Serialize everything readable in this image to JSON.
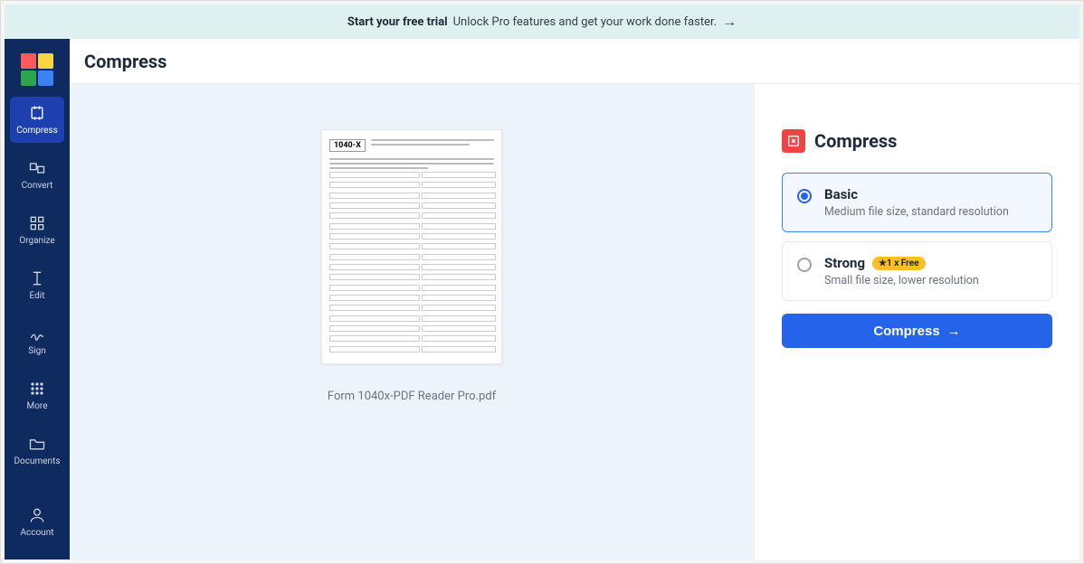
{
  "banner": {
    "bold": "Start your free trial",
    "text": "Unlock Pro features and get your work done faster."
  },
  "header": {
    "title": "Compress"
  },
  "sidebar": {
    "items": [
      {
        "label": "Compress",
        "active": true
      },
      {
        "label": "Convert",
        "active": false
      },
      {
        "label": "Organize",
        "active": false
      },
      {
        "label": "Edit",
        "active": false
      },
      {
        "label": "Sign",
        "active": false
      },
      {
        "label": "More",
        "active": false
      },
      {
        "label": "Documents",
        "active": false
      }
    ],
    "account": {
      "label": "Account"
    }
  },
  "preview": {
    "form_number": "1040-X",
    "filename": "Form 1040x-PDF Reader Pro.pdf"
  },
  "panel": {
    "title": "Compress",
    "options": [
      {
        "title": "Basic",
        "desc": "Medium file size, standard resolution",
        "selected": true,
        "badge": null
      },
      {
        "title": "Strong",
        "desc": "Small file size, lower resolution",
        "selected": false,
        "badge": "★1 x Free"
      }
    ],
    "cta": "Compress"
  }
}
